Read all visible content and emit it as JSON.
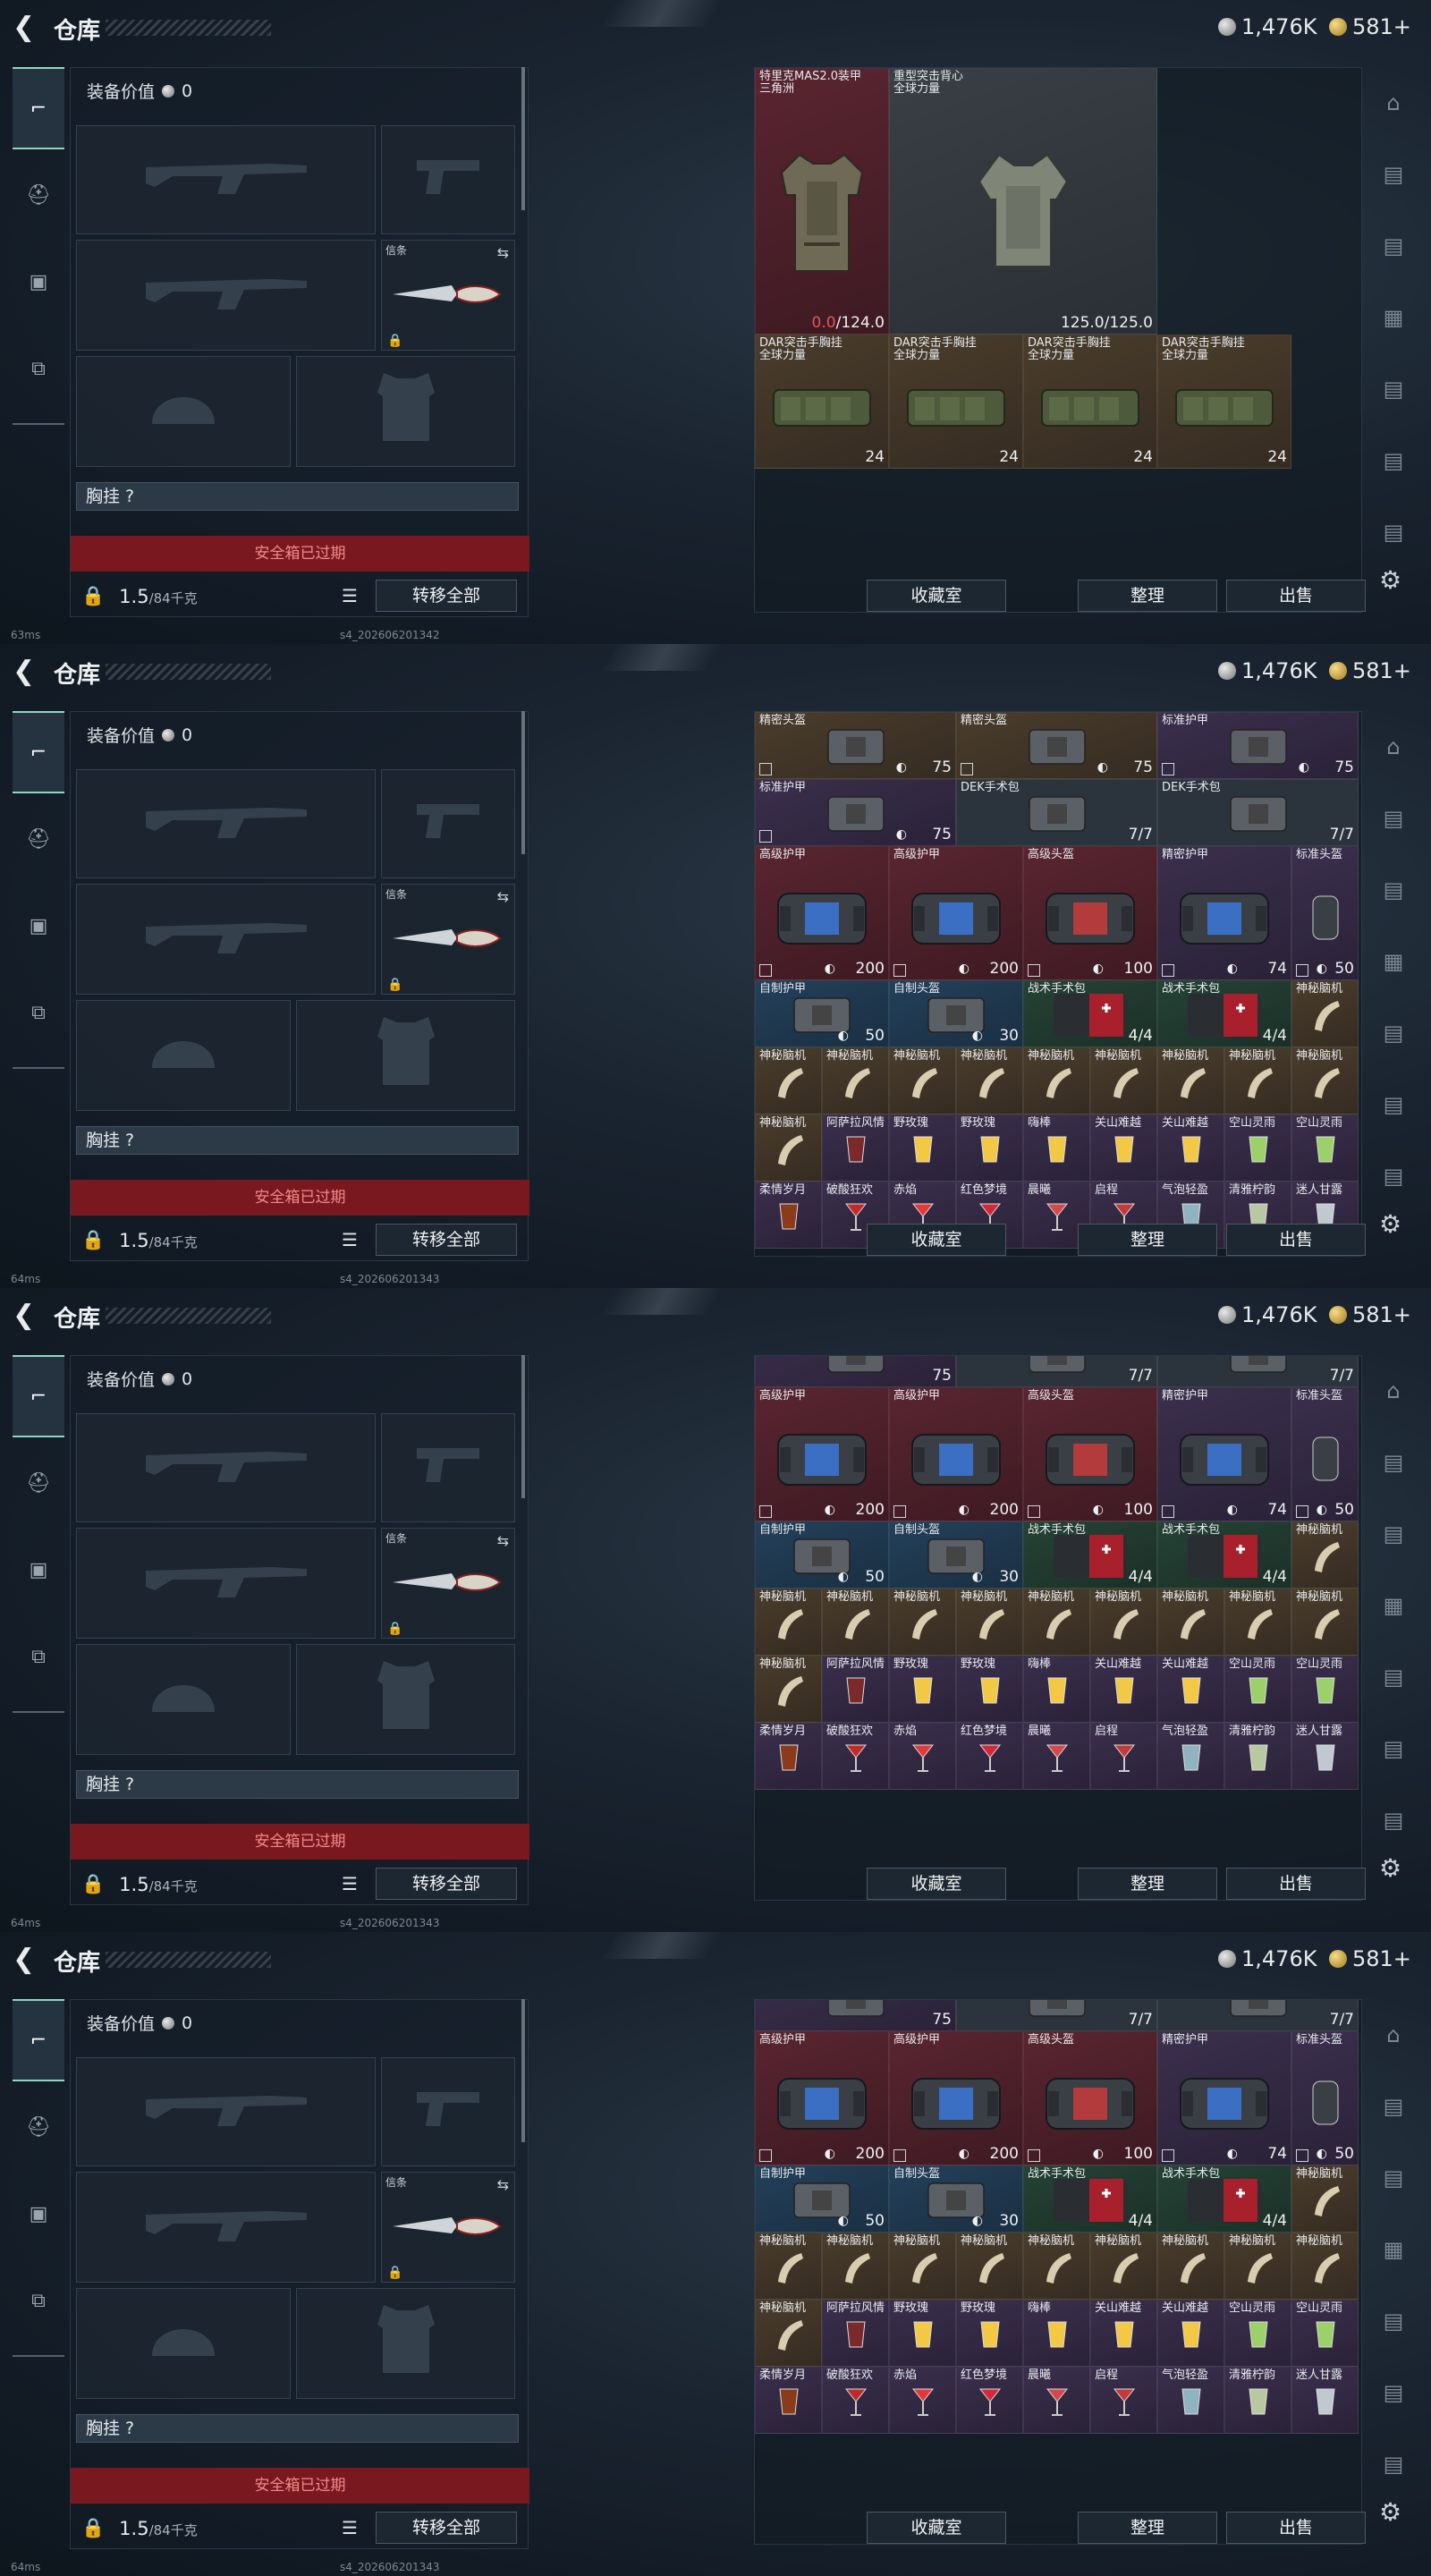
{
  "header": {
    "title": "仓库",
    "silver": "1,476K",
    "gold": "581+"
  },
  "left": {
    "equip_value_label": "装备价值",
    "equip_value": "0",
    "secondary_label": "信条",
    "chest_label": "胸挂 ?",
    "safe_box": "安全箱已过期",
    "weight": "1.5",
    "weight_max": "/84千克",
    "transfer_all": "转移全部"
  },
  "buttons": {
    "collection": "收藏室",
    "sort": "整理",
    "sell": "出售"
  },
  "footers": [
    {
      "ping": "63ms",
      "build": "s4_202606201342"
    },
    {
      "ping": "64ms",
      "build": "s4_202606201343"
    },
    {
      "ping": "64ms",
      "build": "s4_202606201343"
    },
    {
      "ping": "64ms",
      "build": "s4_202606201343"
    }
  ],
  "screen1": {
    "armor": [
      {
        "name": "特里克MAS2.0装甲",
        "sub": "三角洲",
        "dur_cur": "0.0",
        "dur_max": "/124.0"
      },
      {
        "name": "重型突击背心",
        "sub": "全球力量",
        "value": "125.0/125.0"
      }
    ],
    "rigs": [
      {
        "name": "DAR突击手胸挂",
        "sub": "全球力量",
        "cap": "24"
      },
      {
        "name": "DAR突击手胸挂",
        "sub": "全球力量",
        "cap": "24"
      },
      {
        "name": "DAR突击手胸挂",
        "sub": "全球力量",
        "cap": "24"
      },
      {
        "name": "DAR突击手胸挂",
        "sub": "全球力量",
        "cap": "24"
      }
    ]
  },
  "screen2": {
    "row_top": [
      {
        "name": "精密头盔",
        "value": "75"
      },
      {
        "name": "精密头盔",
        "value": "75"
      },
      {
        "name": "标准护甲",
        "value": "75"
      }
    ],
    "row_top2": [
      {
        "name": "标准护甲",
        "value": "75"
      },
      {
        "name": "DEK手术包",
        "value": "7/7"
      },
      {
        "name": "DEK手术包",
        "value": "7/7"
      }
    ]
  },
  "inventory": {
    "big": [
      {
        "name": "高级护甲",
        "value": "200"
      },
      {
        "name": "高级护甲",
        "value": "200"
      },
      {
        "name": "高级头盔",
        "value": "100"
      },
      {
        "name": "精密护甲",
        "value": "74"
      },
      {
        "name": "标准头盔",
        "value": "50"
      }
    ],
    "mid": [
      {
        "name": "自制护甲",
        "value": "50"
      },
      {
        "name": "自制头盔",
        "value": "30"
      },
      {
        "name": "战术手术包",
        "value": "4/4"
      },
      {
        "name": "战术手术包",
        "value": "4/4"
      },
      {
        "name": "神秘脑机",
        "value": ""
      }
    ],
    "r1": [
      "神秘脑机",
      "神秘脑机",
      "神秘脑机",
      "神秘脑机",
      "神秘脑机",
      "神秘脑机",
      "神秘脑机",
      "神秘脑机",
      "神秘脑机"
    ],
    "r2": [
      "神秘脑机",
      "阿萨拉风情",
      "野玫瑰",
      "野玫瑰",
      "嗨棒",
      "关山难越",
      "关山难越",
      "空山灵雨",
      "空山灵雨"
    ],
    "r3": [
      "柔情岁月",
      "破酸狂欢",
      "赤焰",
      "红色梦境",
      "晨曦",
      "启程",
      "气泡轻盈",
      "清雅柠韵",
      "迷人甘露"
    ],
    "partial_top": [
      {
        "value": "75"
      },
      {
        "value": "7/7"
      },
      {
        "value": "7/7"
      }
    ]
  },
  "colors": {
    "accent": "#8fd6c0",
    "safe_bar": "#7a1820",
    "red_value": "#e05555"
  }
}
